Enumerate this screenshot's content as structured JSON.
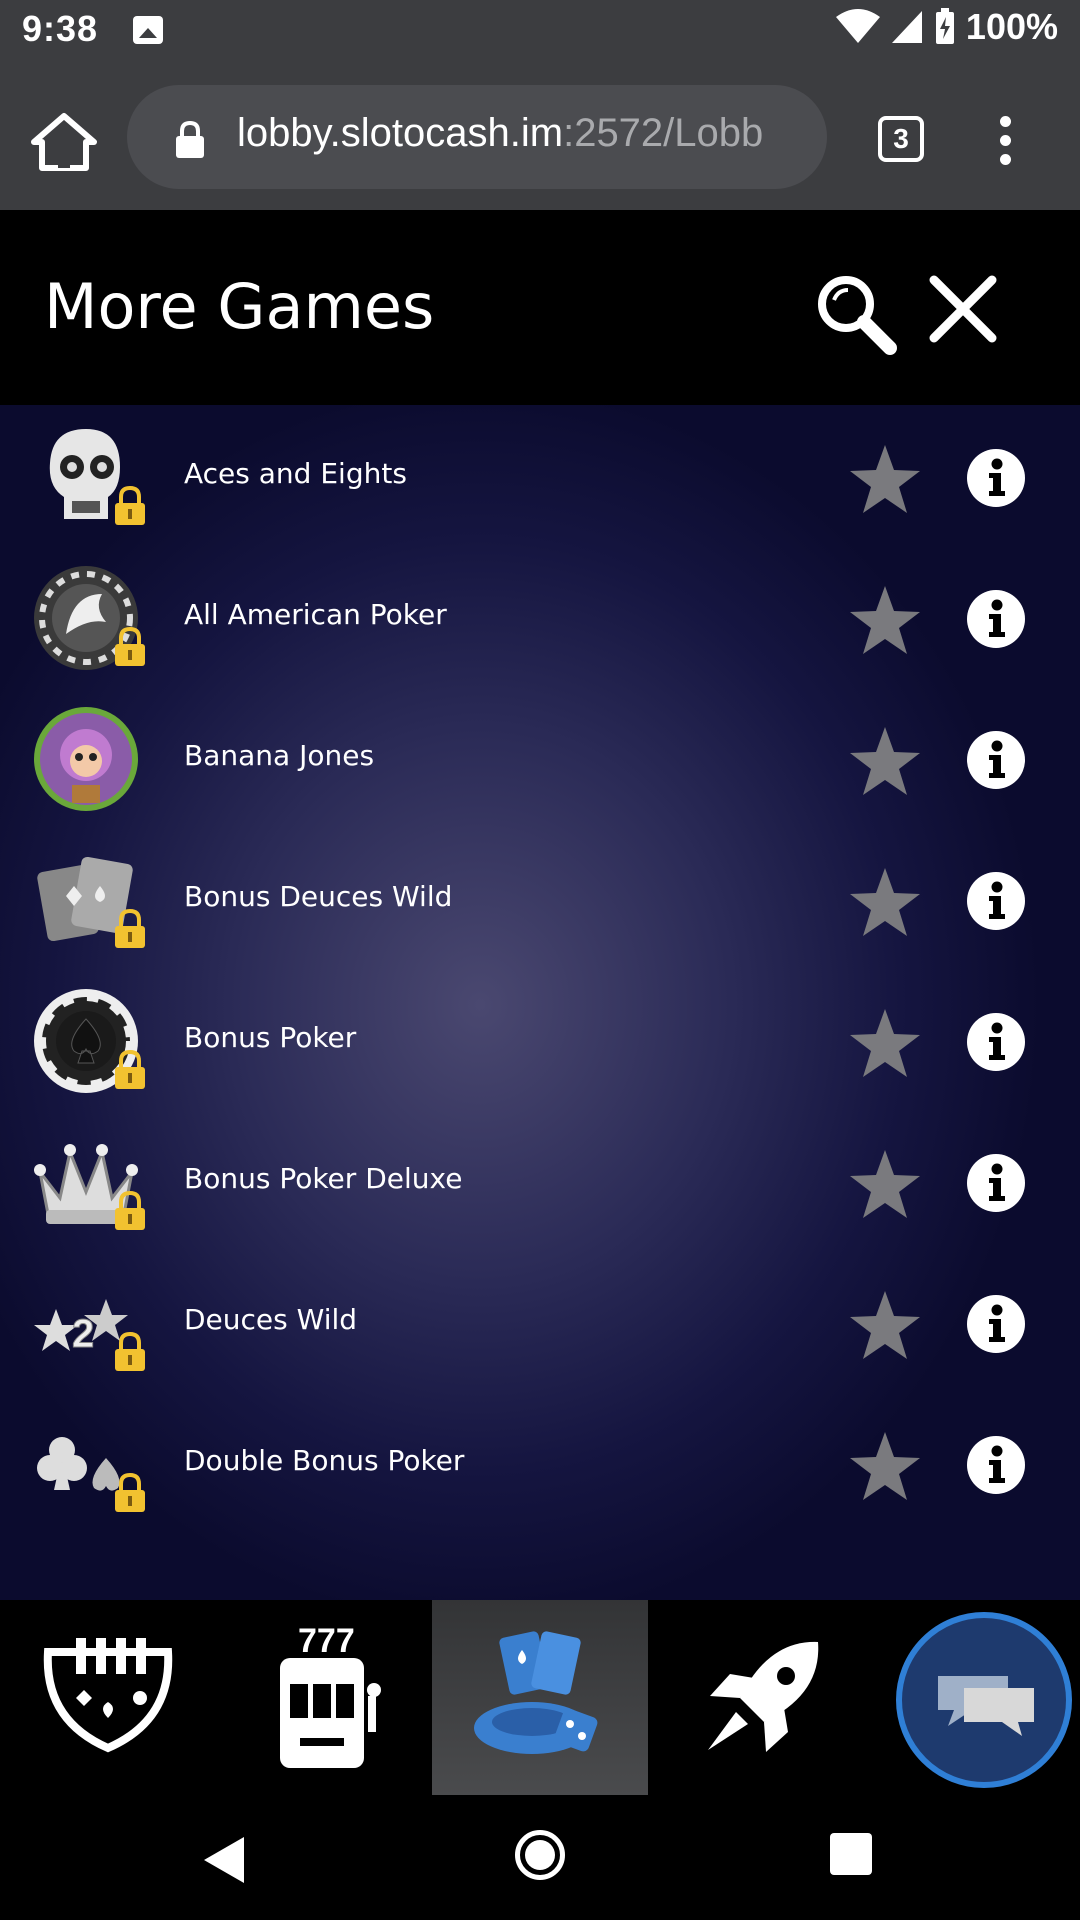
{
  "status_bar": {
    "time": "9:38",
    "battery": "100%",
    "icons": [
      "image-icon",
      "wifi-icon",
      "signal-icon",
      "battery-charging-icon"
    ]
  },
  "browser": {
    "url_host": "lobby.slotocash.im",
    "url_rest": ":2572/Lobb",
    "tab_count": "3",
    "icons": [
      "home-icon",
      "lock-icon",
      "tabs-icon",
      "more-vert-icon"
    ]
  },
  "header": {
    "title": "More Games",
    "icons": [
      "search-icon",
      "close-icon"
    ]
  },
  "games": [
    {
      "name": "Aces and Eights",
      "thumb": "skull-icon",
      "locked": true
    },
    {
      "name": "All American Poker",
      "thumb": "eagle-chip-icon",
      "locked": true
    },
    {
      "name": "Banana Jones",
      "thumb": "monkey-icon",
      "locked": false
    },
    {
      "name": "Bonus Deuces Wild",
      "thumb": "cards-icon",
      "locked": true
    },
    {
      "name": "Bonus Poker",
      "thumb": "spade-chip-icon",
      "locked": true
    },
    {
      "name": "Bonus Poker Deluxe",
      "thumb": "crown-icon",
      "locked": true
    },
    {
      "name": "Deuces Wild",
      "thumb": "deuces-stars-icon",
      "locked": true
    },
    {
      "name": "Double Bonus Poker",
      "thumb": "club-spade-icon",
      "locked": true
    }
  ],
  "bottom_nav": {
    "items": [
      {
        "name": "table-games-icon",
        "active": false
      },
      {
        "name": "slot-machine-icon",
        "active": false
      },
      {
        "name": "specialty-games-icon",
        "active": true
      },
      {
        "name": "rocket-icon",
        "active": false
      }
    ],
    "chat_icon": "chat-icon"
  },
  "colors": {
    "status_bar": "#3c3d40",
    "url_pill": "#4b4c50",
    "list_bg_center": "#4a4870",
    "list_bg_edge": "#0b0b2e",
    "star": "#7a7a7e",
    "lock": "#f2c230",
    "chat_ring": "#2f7fd6",
    "active_nav": "#3b3c3e",
    "specialty_icon": "#3a7fcf"
  }
}
